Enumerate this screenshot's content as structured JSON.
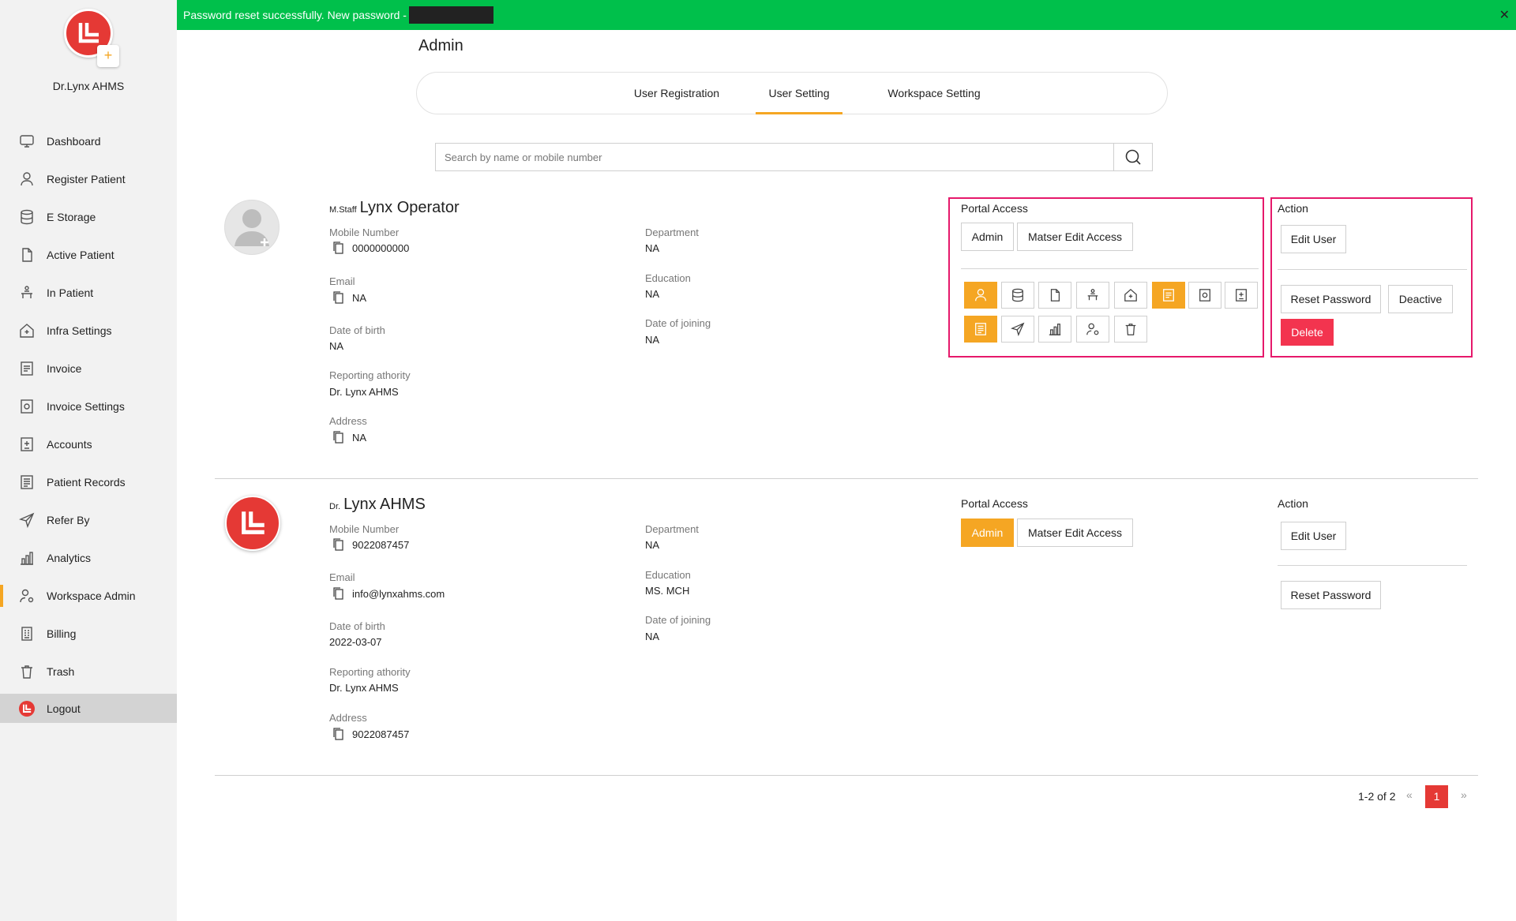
{
  "app": {
    "profile_name": "Dr.Lynx AHMS",
    "add_icon": "plus-icon"
  },
  "sidebar": {
    "items": [
      {
        "label": "Dashboard",
        "icon": "monitor-icon"
      },
      {
        "label": "Register Patient",
        "icon": "user-icon"
      },
      {
        "label": "E Storage",
        "icon": "database-icon"
      },
      {
        "label": "Active Patient",
        "icon": "file-icon"
      },
      {
        "label": "In Patient",
        "icon": "hospital-bed-icon"
      },
      {
        "label": "Infra Settings",
        "icon": "home-plus-icon"
      },
      {
        "label": "Invoice",
        "icon": "invoice-icon"
      },
      {
        "label": "Invoice Settings",
        "icon": "invoice-settings-icon"
      },
      {
        "label": "Accounts",
        "icon": "calculator-icon"
      },
      {
        "label": "Patient Records",
        "icon": "records-icon"
      },
      {
        "label": "Refer By",
        "icon": "send-icon"
      },
      {
        "label": "Analytics",
        "icon": "bar-chart-icon"
      },
      {
        "label": "Workspace Admin",
        "icon": "user-settings-icon"
      },
      {
        "label": "Billing",
        "icon": "bill-icon"
      },
      {
        "label": "Trash",
        "icon": "trash-icon"
      }
    ],
    "active": "Workspace Admin",
    "logout_label": "Logout"
  },
  "banner": {
    "message": "Password reset successfully. New password -",
    "masked_value": "",
    "close_glyph": "✕"
  },
  "page": {
    "title": "Admin",
    "tabs": [
      {
        "label": "User Registration"
      },
      {
        "label": "User Setting"
      },
      {
        "label": "Workspace Setting"
      }
    ],
    "active_tab": "User Setting",
    "search_placeholder": "Search by name or mobile number"
  },
  "labels": {
    "mobile": "Mobile Number",
    "email": "Email",
    "dob": "Date of birth",
    "reporting": "Reporting athority",
    "address": "Address",
    "department": "Department",
    "education": "Education",
    "doj": "Date of joining",
    "portal_access": "Portal Access",
    "action": "Action",
    "admin": "Admin",
    "master_edit": "Matser Edit Access",
    "edit_user": "Edit User",
    "reset_password": "Reset Password",
    "deactive": "Deactive",
    "delete": "Delete"
  },
  "users": [
    {
      "prefix": "M.Staff",
      "name": "Lynx Operator",
      "mobile": "0000000000",
      "email": "NA",
      "dob": "NA",
      "reporting": "Dr. Lynx AHMS",
      "address": "NA",
      "department": "NA",
      "education": "NA",
      "doj": "NA",
      "admin_access": false,
      "permissions": [
        {
          "icon": "user-icon",
          "enabled": true
        },
        {
          "icon": "database-icon",
          "enabled": false
        },
        {
          "icon": "file-icon",
          "enabled": false
        },
        {
          "icon": "hospital-bed-icon",
          "enabled": false
        },
        {
          "icon": "home-plus-icon",
          "enabled": false
        },
        {
          "icon": "invoice-icon",
          "enabled": true
        },
        {
          "icon": "invoice-settings-icon",
          "enabled": false
        },
        {
          "icon": "calculator-icon",
          "enabled": false
        },
        {
          "icon": "records-icon",
          "enabled": true
        },
        {
          "icon": "send-icon",
          "enabled": false
        },
        {
          "icon": "bar-chart-icon",
          "enabled": false
        },
        {
          "icon": "user-settings-icon",
          "enabled": false
        },
        {
          "icon": "trash-icon",
          "enabled": false
        }
      ]
    },
    {
      "prefix": "Dr.",
      "name": "Lynx AHMS",
      "mobile": "9022087457",
      "email": "info@lynxahms.com",
      "dob": "2022-03-07",
      "reporting": "Dr. Lynx AHMS",
      "address": "9022087457",
      "department": "NA",
      "education": "MS. MCH",
      "doj": "NA",
      "admin_access": true
    }
  ],
  "pagination": {
    "range": "1-2 of 2",
    "prev": "«",
    "next": "»",
    "current": "1"
  },
  "colors": {
    "accent": "#f5a623",
    "brand_red": "#e53935",
    "success": "#00c04b",
    "highlight_border": "#e6196b",
    "danger": "#f3344f"
  }
}
